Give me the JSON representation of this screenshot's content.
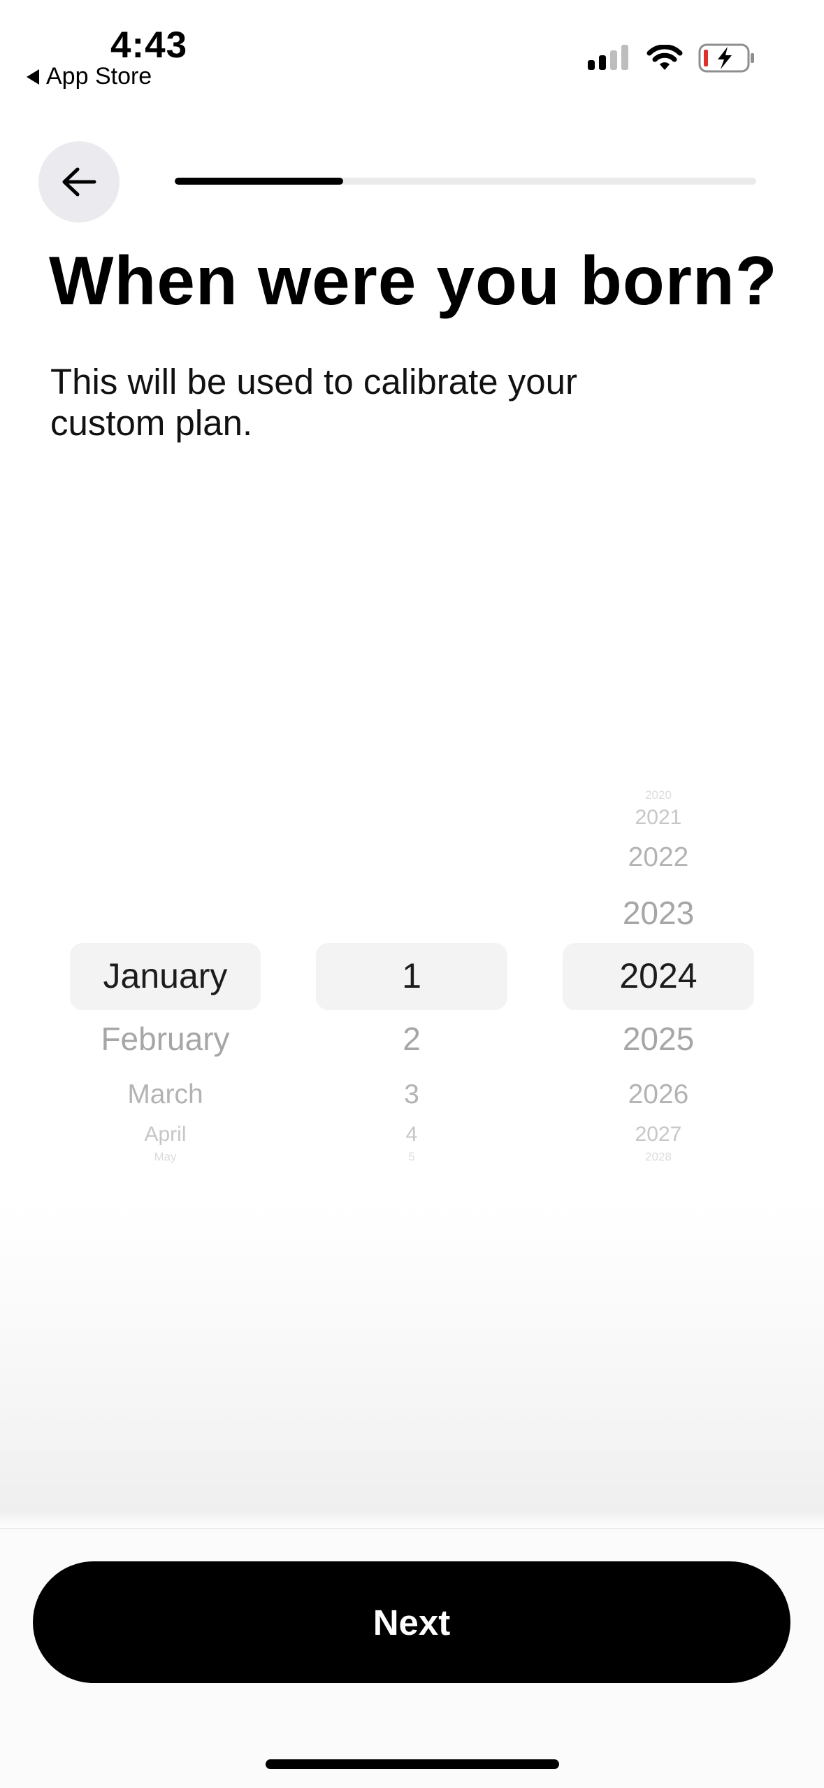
{
  "status_bar": {
    "time": "4:43",
    "back_label": "App Store",
    "icons": [
      "cellular-signal-icon",
      "wifi-icon",
      "battery-charging-icon"
    ]
  },
  "header": {
    "back_icon": "arrow-left-icon",
    "progress_fraction": 0.29
  },
  "title": "When were you born?",
  "subtitle": "This will be used to calibrate your custom plan.",
  "picker": {
    "months": {
      "selected": "January",
      "after": [
        "February",
        "March",
        "April",
        "May"
      ]
    },
    "days": {
      "selected": "1",
      "after": [
        "2",
        "3",
        "4",
        "5"
      ]
    },
    "years": {
      "before": [
        "2020",
        "2021",
        "2022",
        "2023"
      ],
      "selected": "2024",
      "after": [
        "2025",
        "2026",
        "2027",
        "2028"
      ]
    }
  },
  "next_button": {
    "label": "Next"
  },
  "colors": {
    "accent": "#000000",
    "progress_track": "#ebebeb",
    "selection_bg": "#f3f3f3",
    "back_button_bg": "#ebebef"
  }
}
